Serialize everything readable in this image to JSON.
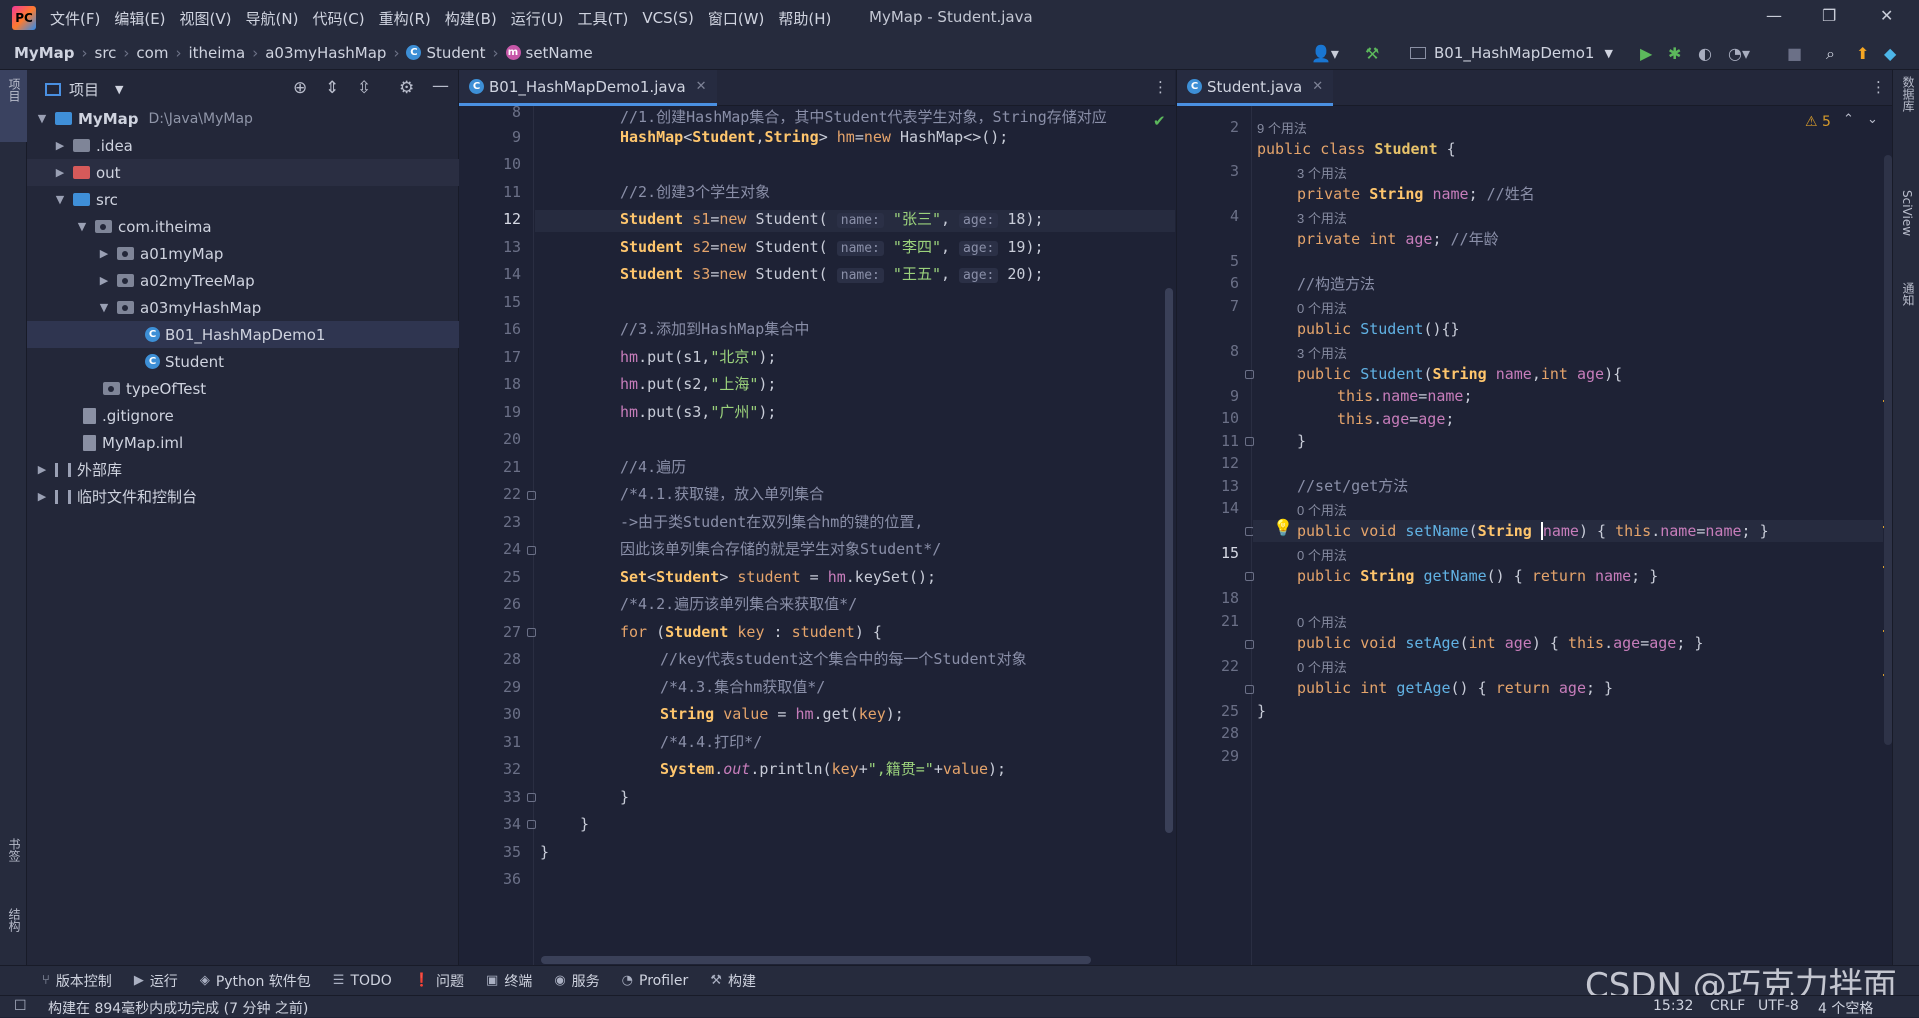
{
  "app": {
    "menu": [
      "文件(F)",
      "编辑(E)",
      "视图(V)",
      "导航(N)",
      "代码(C)",
      "重构(R)",
      "构建(B)",
      "运行(U)",
      "工具(T)",
      "VCS(S)",
      "窗口(W)",
      "帮助(H)"
    ],
    "title": "MyMap - Student.java"
  },
  "breadcrumb": [
    "MyMap",
    "src",
    "com",
    "itheima",
    "a03myHashMap",
    "Student",
    "setName"
  ],
  "run_config": "B01_HashMapDemo1",
  "project_panel": {
    "title": "项目",
    "tree": [
      {
        "label": "MyMap",
        "path": "D:\\Java\\MyMap"
      },
      {
        "label": ".idea"
      },
      {
        "label": "out"
      },
      {
        "label": "src"
      },
      {
        "label": "com.itheima"
      },
      {
        "label": "a01myMap"
      },
      {
        "label": "a02myTreeMap"
      },
      {
        "label": "a03myHashMap"
      },
      {
        "label": "B01_HashMapDemo1"
      },
      {
        "label": "Student"
      },
      {
        "label": "typeOfTest"
      },
      {
        "label": ".gitignore"
      },
      {
        "label": "MyMap.iml"
      },
      {
        "label": "外部库"
      },
      {
        "label": "临时文件和控制台"
      }
    ]
  },
  "left_strip": {
    "project": "项目",
    "bookmarks": "书签",
    "structure": "结构"
  },
  "right_strip": {
    "database": "数据库",
    "sciview": "SciView",
    "notifications": "通知"
  },
  "editor_left": {
    "tab": "B01_HashMapDemo1.java",
    "lines": [
      "8",
      "9",
      "10",
      "11",
      "12",
      "13",
      "14",
      "15",
      "16",
      "17",
      "18",
      "19",
      "20",
      "21",
      "22",
      "23",
      "24",
      "25",
      "26",
      "27",
      "28",
      "29",
      "30",
      "31",
      "32",
      "33",
      "34",
      "35",
      "36"
    ],
    "current_line": "12",
    "code": {
      "l8": "//1.创建HashMap集合，其中Student代表学生对象，String存储对应",
      "l11": "//2.创建3个学生对象",
      "hint_name": "name:",
      "hint_age": "age:",
      "s1_name": "\"张三\"",
      "s2_name": "\"李四\"",
      "s3_name": "\"王五\"",
      "s1_age": "18",
      "s2_age": "19",
      "s3_age": "20",
      "l16": "//3.添加到HashMap集合中",
      "city1": "\"北京\"",
      "city2": "\"上海\"",
      "city3": "\"广州\"",
      "l21": "//4.遍历",
      "l22": "/*4.1.获取键，放入单列集合",
      "l23": "->由于类Student在双列集合hm的键的位置,",
      "l24": "因此该单列集合存储的就是学生对象Student*/",
      "l26": "/*4.2.遍历该单列集合来获取值*/",
      "l28": "//key代表student这个集合中的每一个Student对象",
      "l29": "/*4.3.集合hm获取值*/",
      "l31": "/*4.4.打印*/",
      "native": "\",籍贯=\""
    }
  },
  "editor_right": {
    "tab": "Student.java",
    "warnings": "5",
    "lines": [
      "2",
      "3",
      "4",
      "5",
      "6",
      "7",
      "8",
      "9",
      "10",
      "11",
      "12",
      "13",
      "14",
      "15",
      "18",
      "21",
      "22",
      "25",
      "28",
      "29"
    ],
    "current_line": "15",
    "usages": {
      "u9": "9 个用法",
      "u3": "3 个用法",
      "u0": "0 个用法"
    },
    "code": {
      "name_comment": "//姓名",
      "age_comment": "//年龄",
      "ctor_comment": "//构造方法",
      "setget_comment": "//set/get方法"
    }
  },
  "bottom_tools": [
    "版本控制",
    "运行",
    "Python 软件包",
    "TODO",
    "问题",
    "终端",
    "服务",
    "Profiler",
    "构建"
  ],
  "status": {
    "message": "构建在 894毫秒内成功完成 (7 分钟 之前)",
    "position": "15:32",
    "line_sep": "CRLF",
    "encoding": "UTF-8",
    "indent": "4 个空格"
  },
  "watermark": "CSDN @巧克力拌面",
  "colors": {
    "accent": "#4a90e2",
    "background": "#1e2235",
    "keyword": "#e5a46b",
    "string": "#9bd27c",
    "field": "#c77dbb"
  }
}
